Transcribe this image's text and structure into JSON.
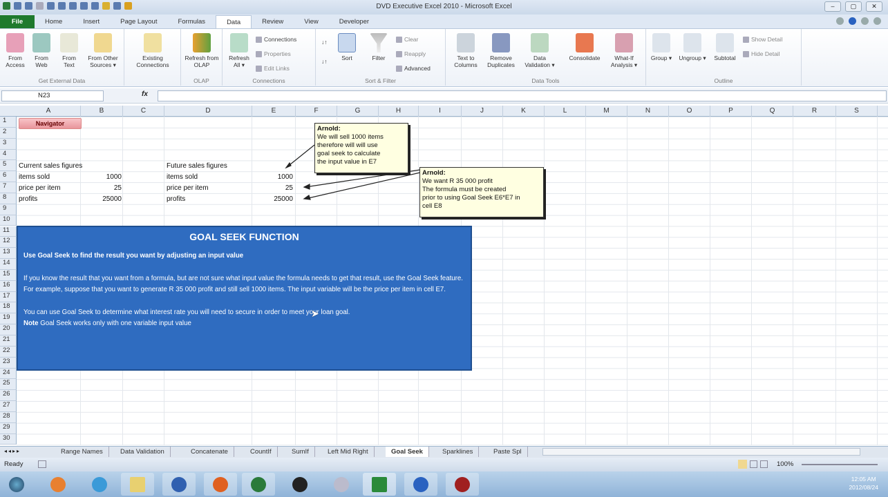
{
  "window": {
    "title": "DVD Executive Excel 2010 - Microsoft Excel",
    "controls": [
      "–",
      "▢",
      "✕"
    ]
  },
  "ribbon_tabs": [
    "File",
    "Home",
    "Insert",
    "Page Layout",
    "Formulas",
    "Data",
    "Review",
    "View",
    "Developer"
  ],
  "active_tab": "Data",
  "ribbon": {
    "get_external": {
      "label": "Get External Data",
      "buttons": [
        "From Access",
        "From Web",
        "From Text",
        "From Other Sources ▾"
      ]
    },
    "existing": "Existing Connections",
    "olap": {
      "label": "OLAP",
      "button": "Refresh from OLAP"
    },
    "connections": {
      "label": "Connections",
      "refresh": "Refresh All ▾",
      "small": [
        "Connections",
        "Properties",
        "Edit Links"
      ]
    },
    "sort_filter": {
      "label": "Sort & Filter",
      "sort": "Sort",
      "filter": "Filter",
      "small": [
        "Clear",
        "Reapply",
        "Advanced"
      ]
    },
    "data_tools": {
      "label": "Data Tools",
      "buttons": [
        "Text to Columns",
        "Remove Duplicates",
        "Data Validation ▾",
        "Consolidate",
        "What-If Analysis ▾"
      ]
    },
    "outline": {
      "label": "Outline",
      "buttons": [
        "Group ▾",
        "Ungroup ▾",
        "Subtotal"
      ],
      "small": [
        "Show Detail",
        "Hide Detail"
      ]
    }
  },
  "formula_bar": {
    "name_box": "N23",
    "fx": "fx",
    "value": ""
  },
  "columns": [
    "A",
    "B",
    "C",
    "D",
    "E",
    "F",
    "G",
    "H",
    "I",
    "J",
    "K",
    "L",
    "M",
    "N",
    "O",
    "P",
    "Q",
    "R",
    "S"
  ],
  "rows": [
    "1",
    "2",
    "3",
    "4",
    "5",
    "6",
    "7",
    "8",
    "9",
    "10",
    "11",
    "12",
    "13",
    "14",
    "15",
    "16",
    "17",
    "18",
    "19",
    "20",
    "21",
    "22",
    "23",
    "24",
    "25",
    "26",
    "27",
    "28",
    "29",
    "30"
  ],
  "nav_button": "Navigator",
  "current": {
    "header": "Current sales figures",
    "items_label": "items sold",
    "items": "1000",
    "price_label": "price per item",
    "price": "25",
    "profit_label": "profits",
    "profit": "25000"
  },
  "future": {
    "header": "Future sales figures",
    "items_label": "items sold",
    "items": "1000",
    "price_label": "price per item",
    "price": "25",
    "profit_label": "profits",
    "profit": "25000"
  },
  "note1": {
    "author": "Arnold:",
    "lines": [
      "We will sell 1000 items",
      "therefore will will use",
      "goal seek to calculate",
      "the input value in E7"
    ]
  },
  "note2": {
    "author": "Arnold:",
    "lines": [
      "We want R 35 000 profit",
      "The formula must be created",
      "prior to using Goal Seek E6*E7 in",
      "cell E8"
    ]
  },
  "info_box": {
    "title": "GOAL SEEK FUNCTION",
    "p1": "Use Goal Seek to find the result you want by adjusting an input value",
    "p2": "If you know the result that you want from a formula, but are not sure what input value the formula needs to get that result, use the Goal Seek feature. For example, suppose that you want to generate R 35 000 profit and still sell 1000 items. The input variable will be the price per item in cell E7.",
    "p3": "You can use Goal Seek to determine what interest rate you will need to secure in order to meet your loan goal.",
    "note_label": "Note",
    "note": " Goal Seek works only with one variable input value"
  },
  "sheet_tabs": [
    "Range Names",
    "Data Validation",
    "Concatenate",
    "CountIf",
    "SumIf",
    "Left Mid Right",
    "Goal Seek",
    "Sparklines",
    "Paste Spl"
  ],
  "active_sheet": "Goal Seek",
  "status": {
    "ready": "Ready",
    "zoom": "100%"
  },
  "clock": {
    "time": "12:05 AM",
    "date": "2012/08/24"
  }
}
